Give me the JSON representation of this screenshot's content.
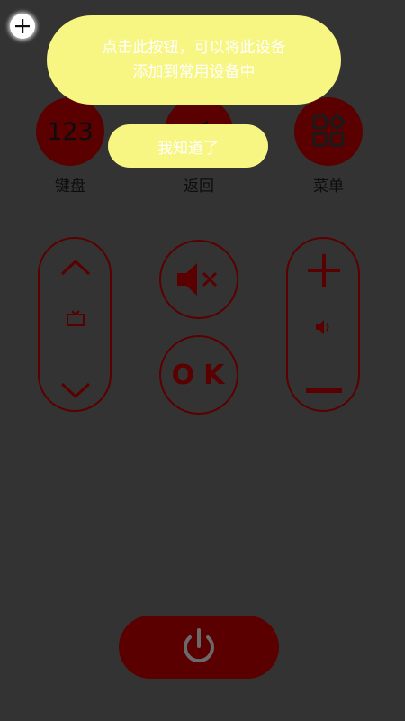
{
  "tooltip": {
    "line1": "点击此按钮，可以将此设备",
    "line2": "添加到常用设备中",
    "confirm_label": "我知道了"
  },
  "top_buttons": {
    "keyboard": {
      "icon_text": "123",
      "label": "键盘"
    },
    "back": {
      "label": "返回"
    },
    "menu": {
      "label": "菜单"
    }
  },
  "center": {
    "ok_label": "OK"
  },
  "colors": {
    "background": "#333333",
    "button_dark_red": "#5a0000",
    "tooltip_yellow": "#f8f682"
  }
}
